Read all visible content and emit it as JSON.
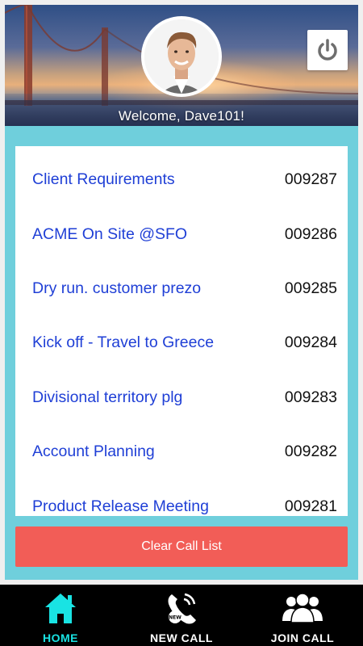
{
  "header": {
    "welcome_text": "Welcome, Dave101!",
    "avatar_icon": "user-avatar",
    "power_icon": "power-icon"
  },
  "call_list": {
    "items": [
      {
        "title": "Client Requirements",
        "id": "009287"
      },
      {
        "title": "ACME On Site @SFO",
        "id": "009286"
      },
      {
        "title": "Dry run. customer prezo",
        "id": "009285"
      },
      {
        "title": "Kick off - Travel to Greece",
        "id": "009284"
      },
      {
        "title": "Divisional territory plg",
        "id": "009283"
      },
      {
        "title": "Account Planning",
        "id": "009282"
      },
      {
        "title": "Product Release Meeting",
        "id": "009281"
      }
    ]
  },
  "actions": {
    "clear_label": "Clear Call List"
  },
  "nav": {
    "items": [
      {
        "label": "HOME",
        "icon": "home-icon",
        "active": true
      },
      {
        "label": "NEW CALL",
        "icon": "new-call-icon",
        "active": false
      },
      {
        "label": "JOIN CALL",
        "icon": "join-call-icon",
        "active": false
      }
    ]
  },
  "colors": {
    "accent": "#19e3e3",
    "frame": "#6fcfdc",
    "link": "#1f3fd6",
    "danger": "#f25d57",
    "nav_bg": "#000000"
  }
}
